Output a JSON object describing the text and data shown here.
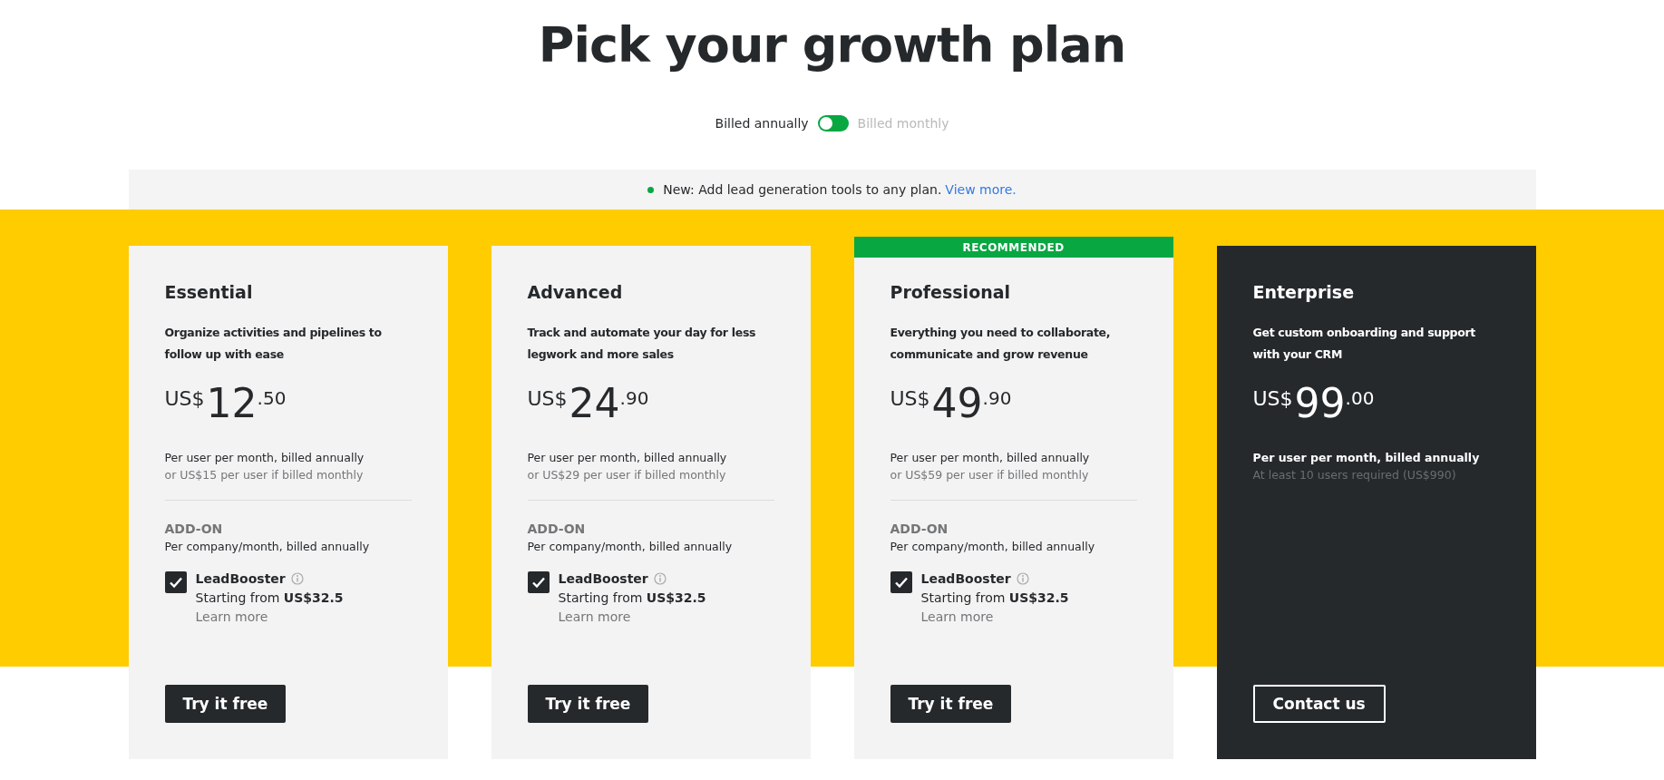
{
  "title": "Pick your growth plan",
  "billing": [
    {
      "label": "Billed annually",
      "selected": true
    },
    {
      "label": "Billed monthly",
      "selected": false
    }
  ],
  "notice": {
    "text": "New: Add lead generation tools to any plan.",
    "link": "View more.",
    "color": "#08a742"
  },
  "plans": [
    {
      "kind": "standard",
      "recommended": false,
      "name": "Essential",
      "description": "Organize activities and pipelines to follow up with ease",
      "currency": "US$",
      "price_whole": "12",
      "price_cents": ".50",
      "billing_note": "Per user per month, billed annually",
      "secondary_note": "or US$15 per user if billed monthly",
      "addon": {
        "heading": "ADD-ON",
        "note": "Per company/month, billed annually",
        "name": "LeadBooster",
        "checked": true,
        "price": "Starting from **US$32.5**",
        "link": "Learn more"
      },
      "button": "Try it free"
    },
    {
      "kind": "standard",
      "recommended": false,
      "name": "Advanced",
      "description": "Track and automate your day for less legwork and more sales",
      "currency": "US$",
      "price_whole": "24",
      "price_cents": ".90",
      "billing_note": "Per user per month, billed annually",
      "secondary_note": "or US$29 per user if billed monthly",
      "addon": {
        "heading": "ADD-ON",
        "note": "Per company/month, billed annually",
        "name": "LeadBooster",
        "checked": true,
        "price": "Starting from **US$32.5**",
        "link": "Learn more"
      },
      "button": "Try it free"
    },
    {
      "kind": "standard",
      "recommended": true,
      "badge": "RECOMMENDED",
      "name": "Professional",
      "description": "Everything you need to collaborate, communicate and grow revenue",
      "currency": "US$",
      "price_whole": "49",
      "price_cents": ".90",
      "billing_note": "Per user per month, billed annually",
      "secondary_note": "or US$59 per user if billed monthly",
      "addon": {
        "heading": "ADD-ON",
        "note": "Per company/month, billed annually",
        "name": "LeadBooster",
        "checked": true,
        "price": "Starting from **US$32.5**",
        "link": "Learn more"
      },
      "button": "Try it free"
    },
    {
      "kind": "enterprise",
      "recommended": false,
      "name": "Enterprise",
      "description": "Get custom onboarding and support with your CRM",
      "currency": "US$",
      "price_whole": "99",
      "price_cents": ".00",
      "billing_note": "Per user per month, billed annually",
      "secondary_note": "At least 10 users required (US$990)",
      "button": "Contact us"
    }
  ]
}
